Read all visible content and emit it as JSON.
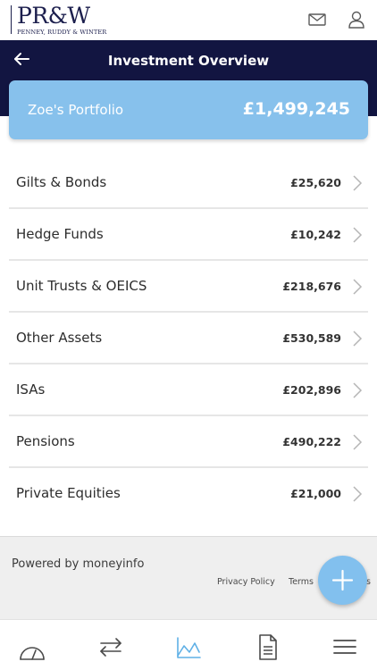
{
  "brand": {
    "logo_mark": "PR&W",
    "logo_sub": "PENNEY, RUDDY & WINTER"
  },
  "header": {
    "title": "Investment Overview",
    "icons": [
      "mail-icon",
      "user-icon",
      "back-arrow-icon"
    ]
  },
  "portfolio": {
    "name": "Zoe's Portfolio",
    "total": "£1,499,245"
  },
  "categories": [
    {
      "label": "Gilts & Bonds",
      "amount": "£25,620"
    },
    {
      "label": "Hedge Funds",
      "amount": "£10,242"
    },
    {
      "label": "Unit Trusts & OEICS",
      "amount": "£218,676"
    },
    {
      "label": "Other Assets",
      "amount": "£530,589"
    },
    {
      "label": "ISAs",
      "amount": "£202,896"
    },
    {
      "label": "Pensions",
      "amount": "£490,222"
    },
    {
      "label": "Private Equities",
      "amount": "£21,000"
    }
  ],
  "footer": {
    "powered": "Powered by moneyinfo",
    "privacy": "Privacy Policy",
    "terms": "Terms",
    "terms_tail": "s"
  },
  "tabs": [
    "dashboard-gauge-icon",
    "transfer-arrows-icon",
    "chart-icon",
    "document-icon",
    "menu-icon"
  ],
  "colors": {
    "navy": "#121541",
    "accent": "#87c1ec",
    "active_tab": "#5fb0e6"
  }
}
